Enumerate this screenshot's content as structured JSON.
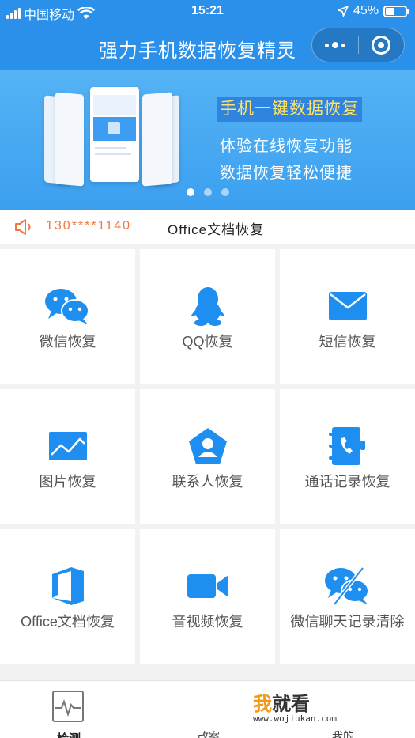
{
  "status_bar": {
    "carrier": "中国移动",
    "time": "15:21",
    "battery": "45%",
    "battery_level": 0.45
  },
  "navbar": {
    "title": "强力手机数据恢复精灵",
    "more_icon": "more-dots-icon",
    "close_icon": "close-ring-icon"
  },
  "banner": {
    "highlight": "手机一键数据恢复",
    "line2": "体验在线恢复功能",
    "line3": "数据恢复轻松便捷",
    "page_count": 3,
    "active_page": 1
  },
  "notice": {
    "phone": "130****1140",
    "text": "Office文档恢复",
    "icon": "speaker-icon"
  },
  "features": [
    {
      "label": "微信恢复",
      "icon": "wechat-icon"
    },
    {
      "label": "QQ恢复",
      "icon": "qq-penguin-icon"
    },
    {
      "label": "短信恢复",
      "icon": "envelope-icon"
    },
    {
      "label": "图片恢复",
      "icon": "picture-icon"
    },
    {
      "label": "联系人恢复",
      "icon": "contact-icon"
    },
    {
      "label": "通话记录恢复",
      "icon": "call-log-icon"
    },
    {
      "label": "Office文档恢复",
      "icon": "office-icon"
    },
    {
      "label": "音视频恢复",
      "icon": "video-camera-icon"
    },
    {
      "label": "微信聊天记录清除",
      "icon": "wechat-clear-icon"
    }
  ],
  "tabbar": {
    "tab_check": "检测",
    "tab_2": "改案",
    "tab_3": "我的"
  },
  "watermark": {
    "brand_a": "我",
    "brand_b": "就看",
    "url": "www.wojiukan.com"
  },
  "colors": {
    "primary": "#2b90ea",
    "accent": "#f07840",
    "icon_blue": "#1e8ef0",
    "highlight_text": "#ffe36a"
  }
}
